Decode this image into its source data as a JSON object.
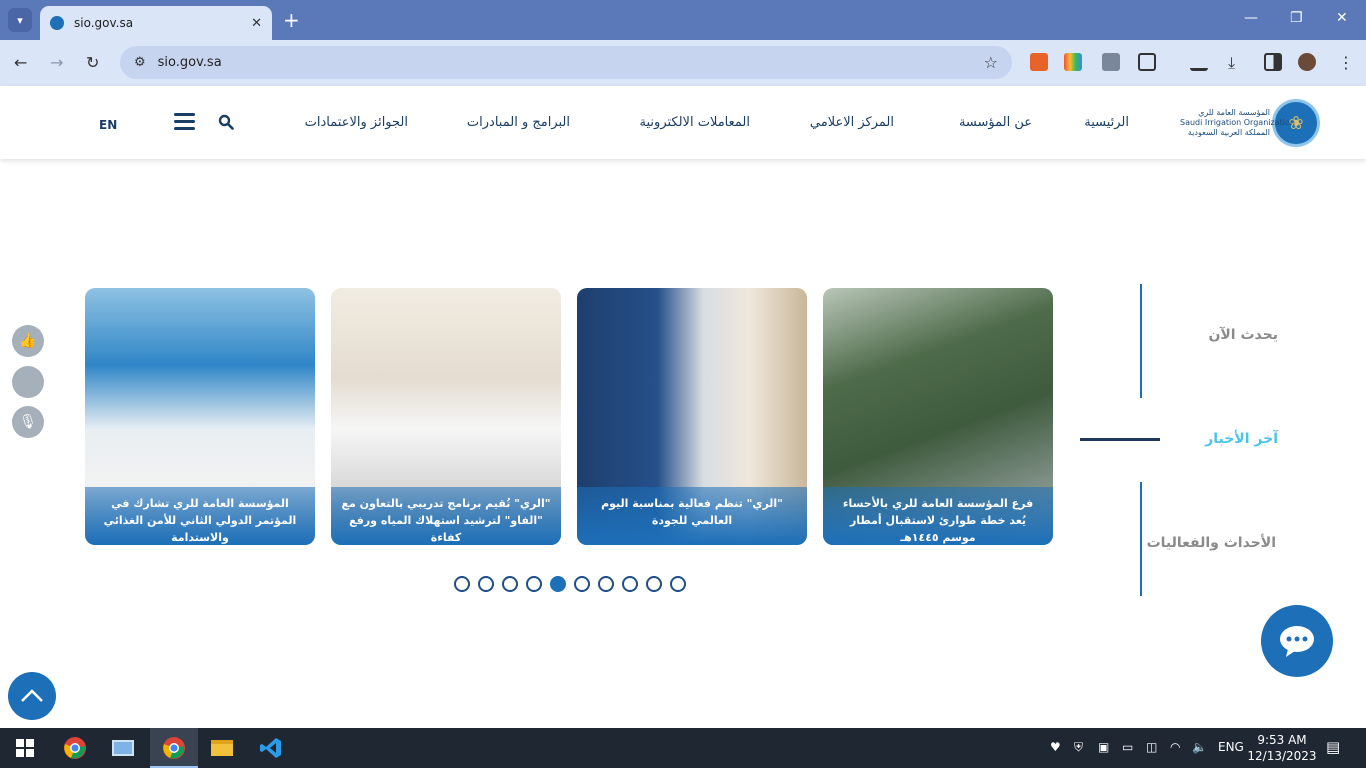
{
  "browser": {
    "tab_title": "sio.gov.sa",
    "url": "sio.gov.sa",
    "new_tab": "+",
    "close": "✕",
    "minimize": "—",
    "restore": "❐",
    "win_close": "✕"
  },
  "header": {
    "logo_lines": [
      "المؤسسة العامة للري",
      "Saudi Irrigation Organization",
      "المملكة العربية السعودية"
    ],
    "menu": [
      "الرئيسية",
      "عن المؤسسة",
      "المركز الاعلامي",
      "المعاملات الالكترونية",
      "البرامج و المبادرات",
      "الجوائز والاعتمادات"
    ],
    "lang": "EN"
  },
  "side_nav": {
    "item1": "يحدث الآن",
    "item2": "آخر الأخبار",
    "item3": "الأحداث والفعاليات"
  },
  "cards": [
    {
      "caption": "فرع المؤسسة العامة للري بالأحساء يُعد خطة طوارئ لاستقبال أمطار موسم ١٤٤٥هـ"
    },
    {
      "caption": "\"الري\" تنظم فعالية بمناسبة اليوم العالمي للجودة"
    },
    {
      "caption": "\"الري\" تُقيم برنامج تدريبي بالتعاون مع \"الفاو\" لترشيد استهلاك المياه ورفع كفاءة"
    },
    {
      "caption": "المؤسسة العامة للري تشارك في المؤتمر الدولي الثاني للأمن الغذائي والاستدامة"
    }
  ],
  "pagination": {
    "count": 10,
    "active_index": 4
  },
  "taskbar": {
    "time": "9:53 AM",
    "date": "12/13/2023",
    "lang": "ENG"
  },
  "colors": {
    "brand": "#1d6fb8",
    "nav_text": "#1a3e63",
    "active_side": "#4cc3e8",
    "inactive_side": "#8a8a8a"
  },
  "icons": [
    "search-icon",
    "hamburger-icon",
    "like-icon",
    "mic-icon",
    "chat-icon",
    "scroll-top-icon",
    "star-icon",
    "back-icon",
    "forward-icon",
    "reload-icon"
  ]
}
